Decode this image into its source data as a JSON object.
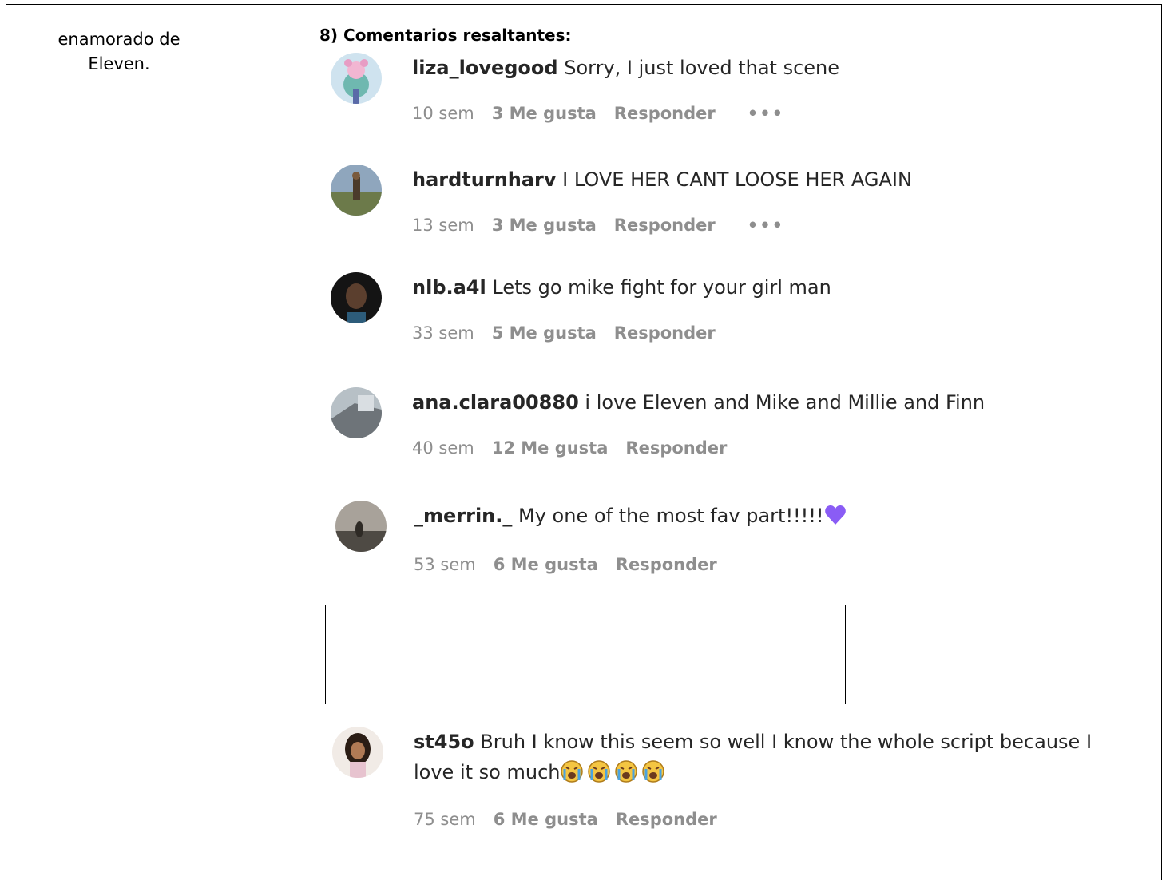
{
  "left_cell": {
    "text": "enamorado de\nEleven."
  },
  "section": {
    "heading": "8) Comentarios resaltantes:"
  },
  "comments": [
    {
      "username": "liza_lovegood",
      "text": " Sorry, I just loved that scene",
      "time": "10 sem",
      "likes": "3 Me gusta",
      "reply": "Responder",
      "more": "•••"
    },
    {
      "username": "hardturnharv",
      "text": " I LOVE HER CANT LOOSE HER AGAIN",
      "time": "13 sem",
      "likes": "3 Me gusta",
      "reply": "Responder",
      "more": "•••"
    },
    {
      "username": "nlb.a4l",
      "text": " Lets go mike fight for your girl man",
      "time": "33 sem",
      "likes": "5 Me gusta",
      "reply": "Responder"
    },
    {
      "username": "ana.clara00880",
      "text": " i love Eleven and Mike and Millie and Finn",
      "time": "40 sem",
      "likes": "12 Me gusta",
      "reply": "Responder"
    },
    {
      "username": "_merrin._",
      "text": " My one of the most fav part!!!!!",
      "time": "53 sem",
      "likes": "6 Me gusta",
      "reply": "Responder"
    },
    {
      "username": "st45o",
      "text": " Bruh I know this seem so well I know the whole script because I love it so much",
      "time": "75 sem",
      "likes": "6 Me gusta",
      "reply": "Responder"
    }
  ],
  "icons": {
    "heart": "purple-heart-emoji",
    "cry": "loudly-crying-face-emoji"
  },
  "colors": {
    "text": "#262626",
    "meta": "#8e8e8e",
    "heart": "#8a5cf5"
  }
}
